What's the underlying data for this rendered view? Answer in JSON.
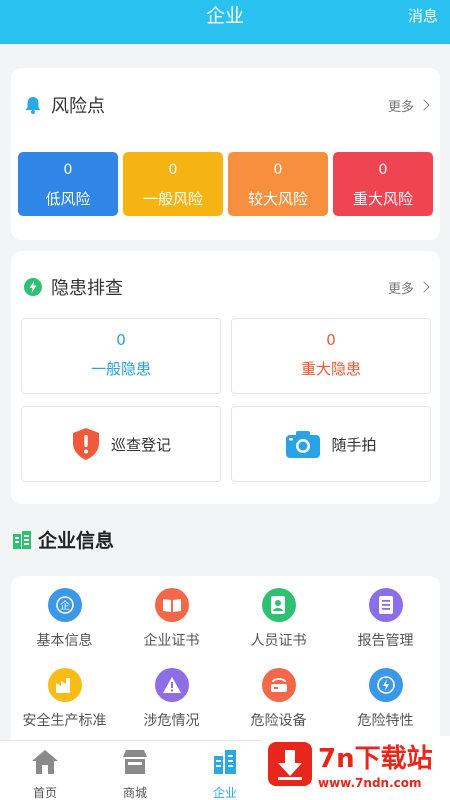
{
  "header": {
    "title": "企业",
    "message_label": "消息"
  },
  "risk": {
    "title": "风险点",
    "more": "更多",
    "items": [
      {
        "count": "0",
        "label": "低风险",
        "color": "#2f86e6"
      },
      {
        "count": "0",
        "label": "一般风险",
        "color": "#f6b314"
      },
      {
        "count": "0",
        "label": "较大风险",
        "color": "#f88f3f"
      },
      {
        "count": "0",
        "label": "重大风险",
        "color": "#ef4451"
      }
    ]
  },
  "hazard": {
    "title": "隐患排查",
    "more": "更多",
    "general": {
      "count": "0",
      "label": "一般隐患",
      "color": "#2aa0d8"
    },
    "major": {
      "count": "0",
      "label": "重大隐患",
      "color": "#ef5b33"
    },
    "actions": [
      {
        "label": "巡查登记",
        "icon": "shield-alert-icon"
      },
      {
        "label": "随手拍",
        "icon": "camera-icon"
      }
    ]
  },
  "company_info": {
    "title": "企业信息",
    "items": [
      {
        "label": "基本信息",
        "icon": "basic-info-icon",
        "color": "#3b97e8"
      },
      {
        "label": "企业证书",
        "icon": "company-certificate-icon",
        "color": "#f4684a"
      },
      {
        "label": "人员证书",
        "icon": "personnel-certificate-icon",
        "color": "#2fc172"
      },
      {
        "label": "报告管理",
        "icon": "report-management-icon",
        "color": "#8b6fe8"
      },
      {
        "label": "安全生产标准",
        "icon": "safety-standard-icon",
        "color": "#f7bd16"
      },
      {
        "label": "涉危情况",
        "icon": "hazard-involvement-icon",
        "color": "#8d6ee6"
      },
      {
        "label": "危险设备",
        "icon": "dangerous-equipment-icon",
        "color": "#f4684a"
      },
      {
        "label": "危险特性",
        "icon": "dangerous-properties-icon",
        "color": "#3b97e8"
      }
    ]
  },
  "tabbar": {
    "tabs": [
      {
        "label": "首页",
        "icon": "home-icon",
        "active": false
      },
      {
        "label": "商城",
        "icon": "shop-icon",
        "active": false
      },
      {
        "label": "企业",
        "icon": "enterprise-icon",
        "active": true
      }
    ]
  },
  "watermark": {
    "title": "7n下载站",
    "url": "www.7ndn.com"
  }
}
